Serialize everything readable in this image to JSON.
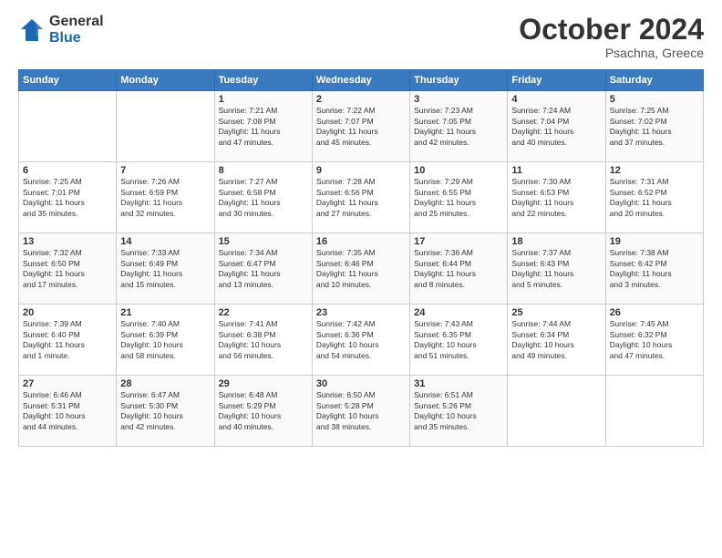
{
  "header": {
    "logo_general": "General",
    "logo_blue": "Blue",
    "month_title": "October 2024",
    "location": "Psachna, Greece"
  },
  "days_of_week": [
    "Sunday",
    "Monday",
    "Tuesday",
    "Wednesday",
    "Thursday",
    "Friday",
    "Saturday"
  ],
  "weeks": [
    [
      {
        "day": "",
        "info": ""
      },
      {
        "day": "",
        "info": ""
      },
      {
        "day": "1",
        "info": "Sunrise: 7:21 AM\nSunset: 7:08 PM\nDaylight: 11 hours\nand 47 minutes."
      },
      {
        "day": "2",
        "info": "Sunrise: 7:22 AM\nSunset: 7:07 PM\nDaylight: 11 hours\nand 45 minutes."
      },
      {
        "day": "3",
        "info": "Sunrise: 7:23 AM\nSunset: 7:05 PM\nDaylight: 11 hours\nand 42 minutes."
      },
      {
        "day": "4",
        "info": "Sunrise: 7:24 AM\nSunset: 7:04 PM\nDaylight: 11 hours\nand 40 minutes."
      },
      {
        "day": "5",
        "info": "Sunrise: 7:25 AM\nSunset: 7:02 PM\nDaylight: 11 hours\nand 37 minutes."
      }
    ],
    [
      {
        "day": "6",
        "info": "Sunrise: 7:25 AM\nSunset: 7:01 PM\nDaylight: 11 hours\nand 35 minutes."
      },
      {
        "day": "7",
        "info": "Sunrise: 7:26 AM\nSunset: 6:59 PM\nDaylight: 11 hours\nand 32 minutes."
      },
      {
        "day": "8",
        "info": "Sunrise: 7:27 AM\nSunset: 6:58 PM\nDaylight: 11 hours\nand 30 minutes."
      },
      {
        "day": "9",
        "info": "Sunrise: 7:28 AM\nSunset: 6:56 PM\nDaylight: 11 hours\nand 27 minutes."
      },
      {
        "day": "10",
        "info": "Sunrise: 7:29 AM\nSunset: 6:55 PM\nDaylight: 11 hours\nand 25 minutes."
      },
      {
        "day": "11",
        "info": "Sunrise: 7:30 AM\nSunset: 6:53 PM\nDaylight: 11 hours\nand 22 minutes."
      },
      {
        "day": "12",
        "info": "Sunrise: 7:31 AM\nSunset: 6:52 PM\nDaylight: 11 hours\nand 20 minutes."
      }
    ],
    [
      {
        "day": "13",
        "info": "Sunrise: 7:32 AM\nSunset: 6:50 PM\nDaylight: 11 hours\nand 17 minutes."
      },
      {
        "day": "14",
        "info": "Sunrise: 7:33 AM\nSunset: 6:49 PM\nDaylight: 11 hours\nand 15 minutes."
      },
      {
        "day": "15",
        "info": "Sunrise: 7:34 AM\nSunset: 6:47 PM\nDaylight: 11 hours\nand 13 minutes."
      },
      {
        "day": "16",
        "info": "Sunrise: 7:35 AM\nSunset: 6:46 PM\nDaylight: 11 hours\nand 10 minutes."
      },
      {
        "day": "17",
        "info": "Sunrise: 7:36 AM\nSunset: 6:44 PM\nDaylight: 11 hours\nand 8 minutes."
      },
      {
        "day": "18",
        "info": "Sunrise: 7:37 AM\nSunset: 6:43 PM\nDaylight: 11 hours\nand 5 minutes."
      },
      {
        "day": "19",
        "info": "Sunrise: 7:38 AM\nSunset: 6:42 PM\nDaylight: 11 hours\nand 3 minutes."
      }
    ],
    [
      {
        "day": "20",
        "info": "Sunrise: 7:39 AM\nSunset: 6:40 PM\nDaylight: 11 hours\nand 1 minute."
      },
      {
        "day": "21",
        "info": "Sunrise: 7:40 AM\nSunset: 6:39 PM\nDaylight: 10 hours\nand 58 minutes."
      },
      {
        "day": "22",
        "info": "Sunrise: 7:41 AM\nSunset: 6:38 PM\nDaylight: 10 hours\nand 56 minutes."
      },
      {
        "day": "23",
        "info": "Sunrise: 7:42 AM\nSunset: 6:36 PM\nDaylight: 10 hours\nand 54 minutes."
      },
      {
        "day": "24",
        "info": "Sunrise: 7:43 AM\nSunset: 6:35 PM\nDaylight: 10 hours\nand 51 minutes."
      },
      {
        "day": "25",
        "info": "Sunrise: 7:44 AM\nSunset: 6:34 PM\nDaylight: 10 hours\nand 49 minutes."
      },
      {
        "day": "26",
        "info": "Sunrise: 7:45 AM\nSunset: 6:32 PM\nDaylight: 10 hours\nand 47 minutes."
      }
    ],
    [
      {
        "day": "27",
        "info": "Sunrise: 6:46 AM\nSunset: 5:31 PM\nDaylight: 10 hours\nand 44 minutes."
      },
      {
        "day": "28",
        "info": "Sunrise: 6:47 AM\nSunset: 5:30 PM\nDaylight: 10 hours\nand 42 minutes."
      },
      {
        "day": "29",
        "info": "Sunrise: 6:48 AM\nSunset: 5:29 PM\nDaylight: 10 hours\nand 40 minutes."
      },
      {
        "day": "30",
        "info": "Sunrise: 6:50 AM\nSunset: 5:28 PM\nDaylight: 10 hours\nand 38 minutes."
      },
      {
        "day": "31",
        "info": "Sunrise: 6:51 AM\nSunset: 5:26 PM\nDaylight: 10 hours\nand 35 minutes."
      },
      {
        "day": "",
        "info": ""
      },
      {
        "day": "",
        "info": ""
      }
    ]
  ]
}
